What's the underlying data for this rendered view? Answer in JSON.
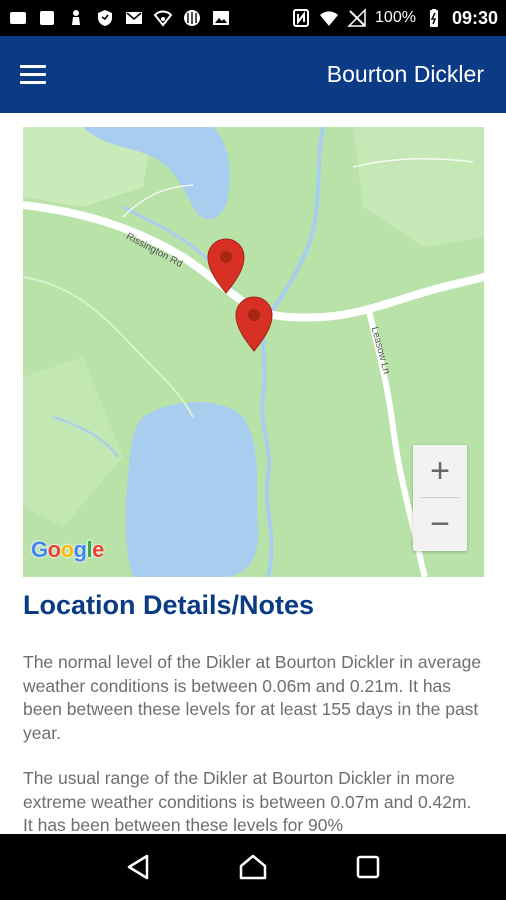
{
  "status_bar": {
    "battery_percent": "100%",
    "time": "09:30"
  },
  "app_bar": {
    "title": "Bourton Dickler",
    "menu_icon": "hamburger-menu-icon"
  },
  "map": {
    "road_labels": [
      "Rissington Rd",
      "Leasow Ln"
    ],
    "zoom_in_label": "+",
    "zoom_out_label": "−",
    "attribution": [
      "G",
      "o",
      "o",
      "g",
      "l",
      "e"
    ],
    "markers": [
      "map-marker-icon",
      "map-marker-icon"
    ]
  },
  "details": {
    "title": "Location Details/Notes",
    "paragraphs": [
      "The normal level of the Dikler at Bourton Dickler in average weather conditions is between 0.06m and 0.21m. It has been between these levels for at least 155 days in the past year.",
      "The usual range of the Dikler at Bourton Dickler in more extreme weather conditions is between 0.07m and 0.42m. It has been between these levels for 90%"
    ]
  },
  "colors": {
    "app_bar": "#0b3b85",
    "title_text": "#0b3b85",
    "map_green": "#b8e2a8",
    "water": "#a9cdef",
    "marker": "#d93025"
  }
}
